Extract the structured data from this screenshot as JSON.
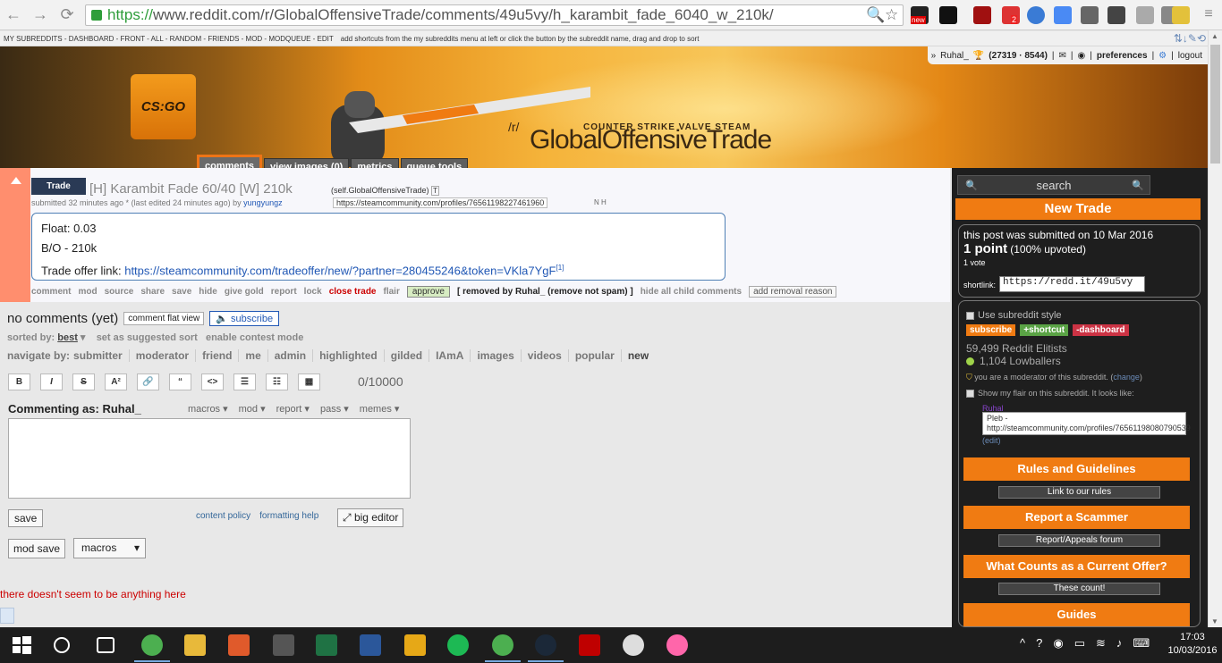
{
  "browser": {
    "url_https": "https://",
    "url_rest": "www.reddit.com/r/GlobalOffensiveTrade/comments/49u5vy/h_karambit_fade_6040_w_210k/",
    "ext_badge_new": "new",
    "ext_badge_count": "2"
  },
  "srbar": {
    "items": "MY SUBREDDITS - DASHBOARD - FRONT - ALL - RANDOM - FRIENDS - MOD - MODQUEUE - EDIT",
    "hint": "add shortcuts from the my subreddits menu at left or click the button by the subreddit name, drag and drop to sort",
    "tools": "⇅↓✎⟲"
  },
  "header": {
    "logo": "CS:GO",
    "r": "/r/",
    "subreddit": "GlobalOffensiveTrade",
    "sponsors": "COUNTER STRIKE   VALVE   STEAM",
    "user": "Ruhal_",
    "karma": "(27319 · 8544)",
    "preferences": "preferences",
    "logout": "logout",
    "tabs": [
      "comments",
      "view images (0)",
      "metrics",
      "queue tools"
    ]
  },
  "post": {
    "flair": "Trade",
    "title": "[H] Karambit Fade 60/40 [W] 210k",
    "domain": "(self.GlobalOffensiveTrade)",
    "tagline_pre": "submitted 32 minutes ago * (last edited 24 minutes ago) by ",
    "author": "yungyungz",
    "profile_link": "https://steamcommunity.com/profiles/76561198227461960",
    "body": {
      "float": "Float: 0.03",
      "bo": "B/O - 210k",
      "trade_label": "Trade offer link: ",
      "trade_url": "https://steamcommunity.com/tradeoffer/new/?partner=280455246&token=VKla7YgF",
      "footnote": "[1]"
    },
    "buttons": [
      "comment",
      "mod",
      "source",
      "share",
      "save",
      "hide",
      "give gold",
      "report",
      "lock"
    ],
    "close_trade": "close trade",
    "flair_btn": "flair",
    "approve": "approve",
    "removed": "[ removed by Ruhal_ (remove not spam) ]",
    "hide_children": "hide all child comments",
    "add_reason": "add removal reason"
  },
  "comments": {
    "heading": "no comments (yet)",
    "flat_view": "comment flat view",
    "subscribe": "subscribe",
    "sorted_label": "sorted by:",
    "sorted_value": "best",
    "suggested": "set as suggested sort",
    "contest": "enable contest mode",
    "navigate_label": "navigate by:",
    "navigate": [
      "submitter",
      "moderator",
      "friend",
      "me",
      "admin",
      "highlighted",
      "gilded",
      "IAmA",
      "images",
      "videos",
      "popular",
      "new"
    ],
    "toolbar": [
      "B",
      "I",
      "S",
      "A²",
      "🔗",
      "“",
      "<>",
      "☰",
      "☷",
      "▦"
    ],
    "charcount": "0/10000",
    "commenting_as": "Commenting as: Ruhal_",
    "menus": [
      "macros ▾",
      "mod ▾",
      "report ▾",
      "pass ▾",
      "memes ▾"
    ],
    "save": "save",
    "content_policy": "content policy",
    "formatting_help": "formatting help",
    "big_editor": "big editor",
    "mod_save": "mod save",
    "macros": "macros",
    "nothing_here": "there doesn't seem to be anything here"
  },
  "sidebar": {
    "search": "search",
    "new_trade": "New Trade",
    "submitted": "this post was submitted on 10 Mar 2016",
    "points": "1 point",
    "upvoted": "(100% upvoted)",
    "votes": "1 vote",
    "shortlink_label": "shortlink:",
    "shortlink": "https://redd.it/49u5vy",
    "use_style": "Use subreddit style",
    "subscribe": "subscribe",
    "shortcut": "+shortcut",
    "dashboard": "-dashboard",
    "elitists": "59,499 Reddit Elitists",
    "lowballers": "1,104 Lowballers",
    "moderator_text": "you are a moderator of this subreddit. (",
    "change": "change",
    "show_flair": "Show my flair on this subreddit. It looks like:",
    "flair_name": "Ruhal_",
    "flair_text": "Pleb - http://steamcommunity.com/profiles/76561198080790539",
    "edit": "(edit)",
    "rules": "Rules and Guidelines",
    "rules_link": "Link to our rules",
    "scammer": "Report a Scammer",
    "scammer_link": "Report/Appeals forum",
    "current": "What Counts as a Current Offer?",
    "current_link": "These count!",
    "guides": "Guides"
  },
  "taskbar": {
    "time": "17:03",
    "date": "10/03/2016"
  },
  "colors": {
    "accent_orange": "#f07b12",
    "link_blue": "#2158b5",
    "removed_red": "#cc0000"
  }
}
